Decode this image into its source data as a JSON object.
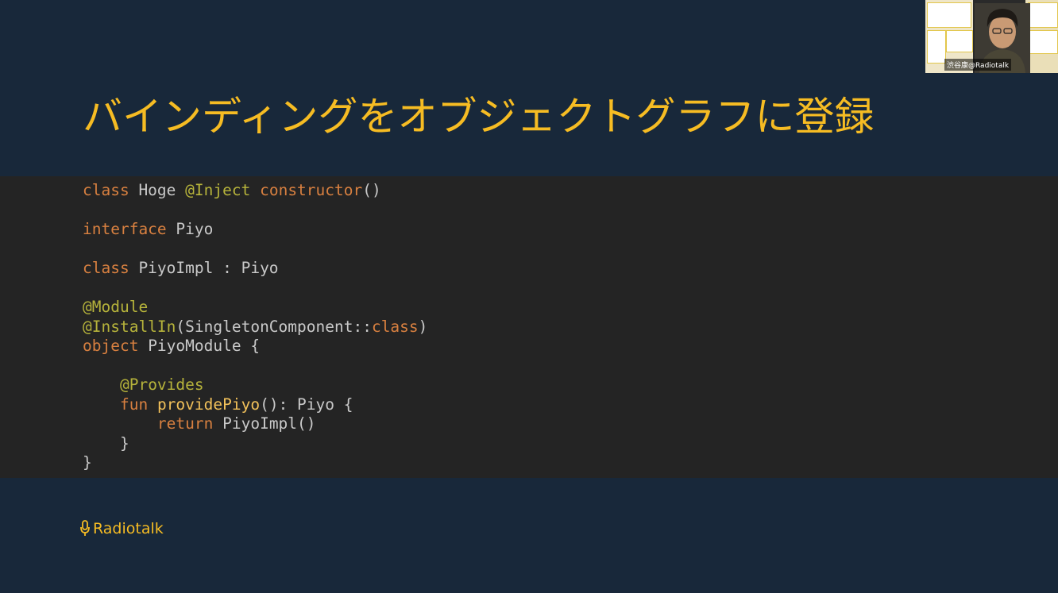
{
  "slide": {
    "title": "バインディングをオブジェクトグラフに登録"
  },
  "code": {
    "lines": [
      [
        {
          "t": "class",
          "k": "kw"
        },
        {
          "t": " Hoge ",
          "k": "plain"
        },
        {
          "t": "@Inject",
          "k": "ann"
        },
        {
          "t": " ",
          "k": "plain"
        },
        {
          "t": "constructor",
          "k": "kw"
        },
        {
          "t": "()",
          "k": "plain"
        }
      ],
      [],
      [
        {
          "t": "interface",
          "k": "kw"
        },
        {
          "t": " Piyo",
          "k": "plain"
        }
      ],
      [],
      [
        {
          "t": "class",
          "k": "kw"
        },
        {
          "t": " PiyoImpl : Piyo",
          "k": "plain"
        }
      ],
      [],
      [
        {
          "t": "@Module",
          "k": "ann"
        }
      ],
      [
        {
          "t": "@InstallIn",
          "k": "ann"
        },
        {
          "t": "(SingletonComponent::",
          "k": "plain"
        },
        {
          "t": "class",
          "k": "kw"
        },
        {
          "t": ")",
          "k": "plain"
        }
      ],
      [
        {
          "t": "object",
          "k": "kw"
        },
        {
          "t": " PiyoModule {",
          "k": "plain"
        }
      ],
      [],
      [
        {
          "t": "    ",
          "k": "plain"
        },
        {
          "t": "@Provides",
          "k": "ann"
        }
      ],
      [
        {
          "t": "    ",
          "k": "plain"
        },
        {
          "t": "fun",
          "k": "kw"
        },
        {
          "t": " ",
          "k": "plain"
        },
        {
          "t": "providePiyo",
          "k": "fn"
        },
        {
          "t": "(): Piyo {",
          "k": "plain"
        }
      ],
      [
        {
          "t": "        ",
          "k": "plain"
        },
        {
          "t": "return",
          "k": "kw"
        },
        {
          "t": " PiyoImpl()",
          "k": "plain"
        }
      ],
      [
        {
          "t": "    }",
          "k": "plain"
        }
      ],
      [
        {
          "t": "}",
          "k": "plain"
        }
      ]
    ]
  },
  "brand": {
    "name": "Radiotalk",
    "icon": "microphone-icon"
  },
  "webcam": {
    "caption": "渋谷康@Radiotalk"
  },
  "colors": {
    "background": "#18283a",
    "code_background": "#242424",
    "accent": "#f6bc23",
    "keyword": "#d88040",
    "annotation": "#b6b33b",
    "function": "#f2c15a",
    "text": "#c9c9c9"
  }
}
